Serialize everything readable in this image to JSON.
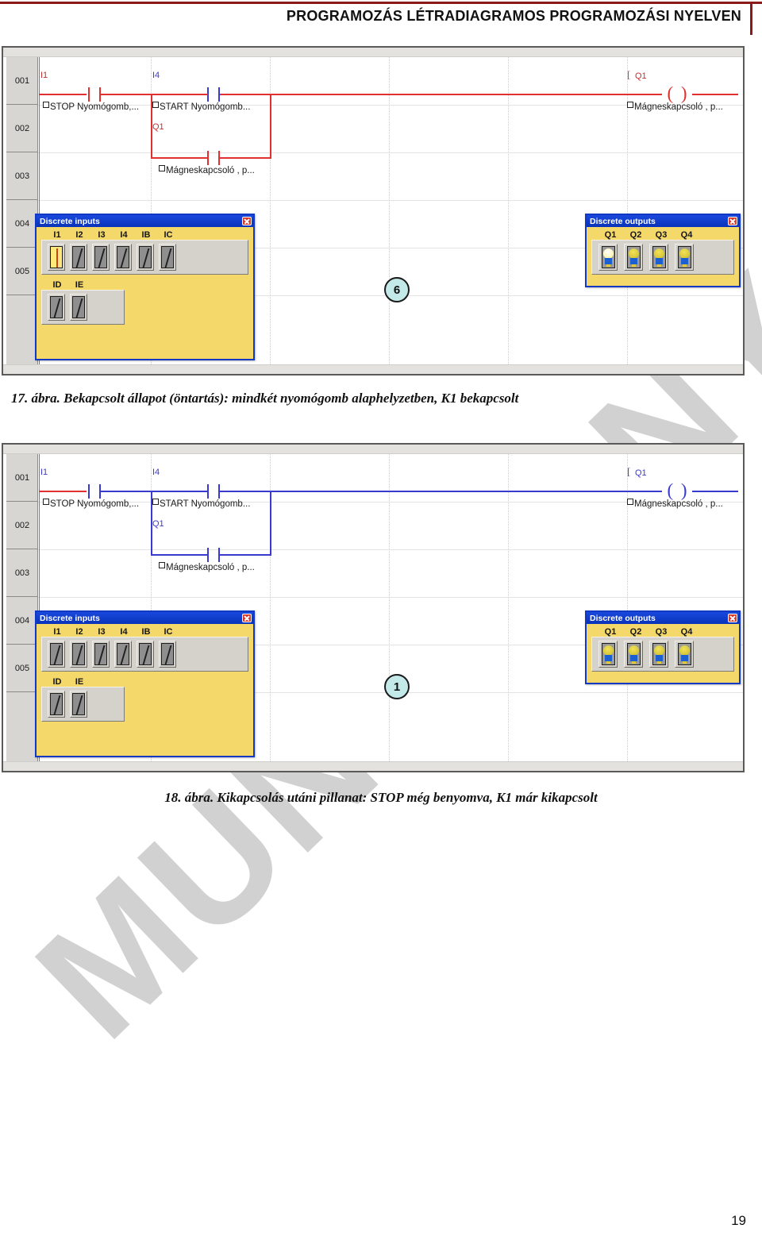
{
  "header": {
    "title": "PROGRAMOZÁS LÉTRADIAGRAMOS PROGRAMOZÁSI NYELVEN",
    "accent_color": "#8c1a1a"
  },
  "watermark": {
    "text": "MUNKAANYAG",
    "color": "#c9c9c9"
  },
  "page": {
    "number": "19"
  },
  "ladder_common": {
    "rows": [
      "001",
      "002",
      "003",
      "004",
      "005"
    ],
    "tag_i1": "I1",
    "tag_i4": "I4",
    "tag_q1_branch": "Q1",
    "tag_q1_coil": "Q1",
    "comment_stop": "STOP Nyomógomb,...",
    "comment_start": "START Nyomógomb...",
    "comment_contactor": "Mágneskapcsoló , p...",
    "comment_coil": "Mágneskapcsoló , p...",
    "coil_symbol": "( )",
    "coil_bracket": "["
  },
  "io_dialogs": {
    "inputs_title": "Discrete inputs",
    "outputs_title": "Discrete outputs",
    "input_labels_row1": [
      "I1",
      "I2",
      "I3",
      "I4",
      "IB",
      "IC"
    ],
    "input_labels_row2": [
      "ID",
      "IE"
    ],
    "output_labels": [
      "Q1",
      "Q2",
      "Q3",
      "Q4"
    ],
    "close_icon": "close-icon",
    "panel_color": "#f5d86a",
    "titlebar_color": "#0a3fd4"
  },
  "figure_17": {
    "badge": "6",
    "caption": "17. ábra. Bekapcsolt állapot (öntartás): mindkét nyomógomb alaphelyzetben, K1 bekapcsolt",
    "wire_color": "#e03030",
    "state_note": "energized",
    "inputs_row1_states": [
      "on",
      "off",
      "off",
      "off",
      "off",
      "off"
    ],
    "inputs_row2_states": [
      "off",
      "off"
    ],
    "outputs_states": [
      "on",
      "off",
      "off",
      "off"
    ]
  },
  "figure_18": {
    "badge": "1",
    "caption": "18. ábra. Kikapcsolás utáni pillanat: STOP még benyomva, K1 már kikapcsolt",
    "wire_color": "#3a3ad0",
    "state_note": "de-energized",
    "inputs_row1_states": [
      "off",
      "off",
      "off",
      "off",
      "off",
      "off"
    ],
    "inputs_row2_states": [
      "off",
      "off"
    ],
    "outputs_states": [
      "off",
      "off",
      "off",
      "off"
    ]
  }
}
